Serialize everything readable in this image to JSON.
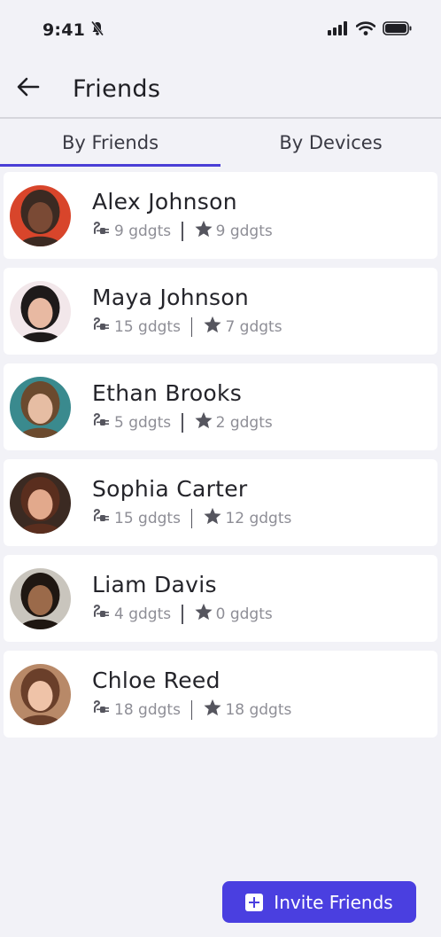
{
  "status_bar": {
    "time": "9:41"
  },
  "header": {
    "title": "Friends"
  },
  "tabs": [
    {
      "label": "By Friends",
      "active": true
    },
    {
      "label": "By Devices",
      "active": false
    }
  ],
  "friends": [
    {
      "name": "Alex Johnson",
      "devices": "9 gdgts",
      "favorites": "9 gdgts",
      "avatar_colors": [
        "#3b2a22",
        "#7a4a35",
        "#d8452b"
      ]
    },
    {
      "name": "Maya Johnson",
      "devices": "15 gdgts",
      "favorites": "7 gdgts",
      "avatar_colors": [
        "#1e1a1a",
        "#e8b9a2",
        "#f2e7ea"
      ]
    },
    {
      "name": "Ethan Brooks",
      "devices": "5 gdgts",
      "favorites": "2 gdgts",
      "avatar_colors": [
        "#6b4a2e",
        "#e6bda3",
        "#3a8a8e"
      ]
    },
    {
      "name": "Sophia Carter",
      "devices": "15 gdgts",
      "favorites": "12 gdgts",
      "avatar_colors": [
        "#5a2e1e",
        "#e2a98c",
        "#3b2a22"
      ]
    },
    {
      "name": "Liam Davis",
      "devices": "4 gdgts",
      "favorites": "0 gdgts",
      "avatar_colors": [
        "#1f1712",
        "#9b6a4a",
        "#c9c5bd"
      ]
    },
    {
      "name": "Chloe Reed",
      "devices": "18 gdgts",
      "favorites": "18 gdgts",
      "avatar_colors": [
        "#6a3f2a",
        "#efc3a8",
        "#b88968"
      ]
    }
  ],
  "invite_button": {
    "label": "Invite Friends"
  },
  "icons": {
    "back": "arrow-left-icon",
    "device": "plug-icon",
    "favorite": "star-icon",
    "add": "plus-square-icon"
  },
  "colors": {
    "accent": "#4a3fe0",
    "background": "#f2f2f7",
    "card": "#ffffff"
  }
}
